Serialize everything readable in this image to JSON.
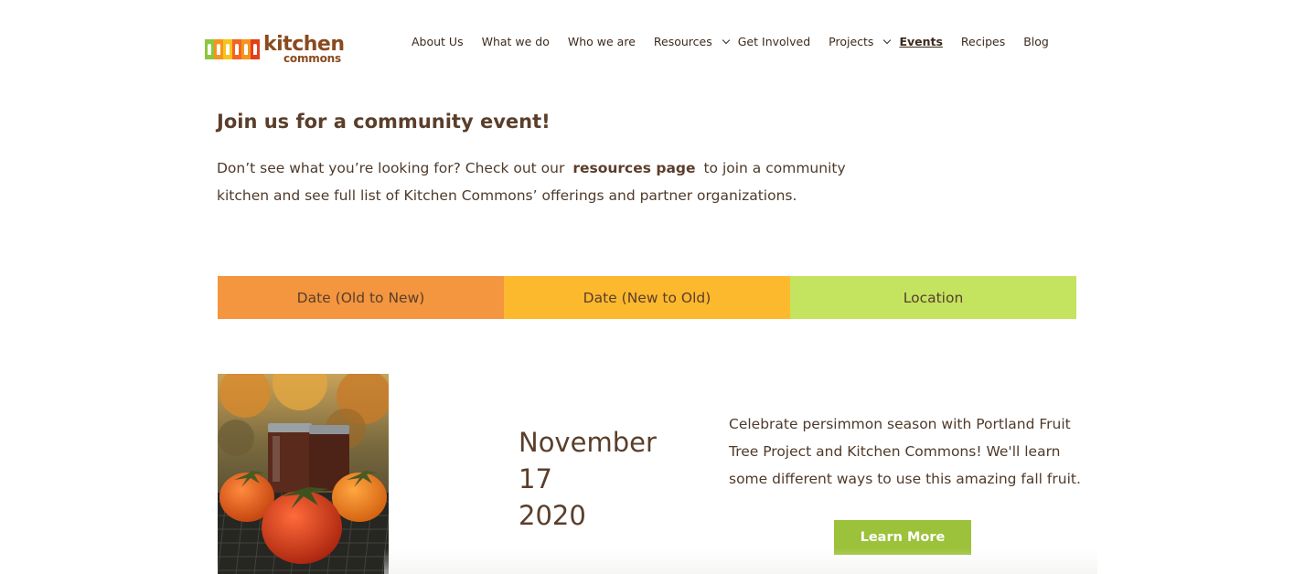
{
  "brand": {
    "logo_line1": "kitchen",
    "logo_line2": "commons",
    "stripe_colors": [
      "#8dc63f",
      "#f7941d",
      "#f7c31d",
      "#f26522",
      "#f7941d",
      "#e2401c"
    ]
  },
  "nav": {
    "items": [
      {
        "label": "About Us"
      },
      {
        "label": "What we do"
      },
      {
        "label": "Who we are"
      },
      {
        "label": "Resources",
        "dropdown": true
      },
      {
        "label": "Get Involved"
      },
      {
        "label": "Projects",
        "dropdown": true
      },
      {
        "label": "Events",
        "active": true
      },
      {
        "label": "Recipes"
      },
      {
        "label": "Blog"
      }
    ]
  },
  "intro": {
    "heading": "Join us for a community event!",
    "text_before": "Don’t see what you’re looking for? Check out our",
    "link_text": "resources page",
    "text_after": "to join a community kitchen and see full list of Kitchen Commons’ offerings and partner organizations."
  },
  "sort_tabs": [
    {
      "label": "Date (Old to New)",
      "color": "#f3963f"
    },
    {
      "label": "Date (New to Old)",
      "color": "#fdb92e"
    },
    {
      "label": "Location",
      "color": "#c4e35f"
    }
  ],
  "event": {
    "month": "November",
    "day": "17",
    "year": "2020",
    "description": "Celebrate persimmon season with Portland Fruit Tree Project and Kitchen Commons! We'll learn some different ways to use this amazing fall fruit.",
    "button_label": "Learn More",
    "button_color": "#9cc13a"
  }
}
